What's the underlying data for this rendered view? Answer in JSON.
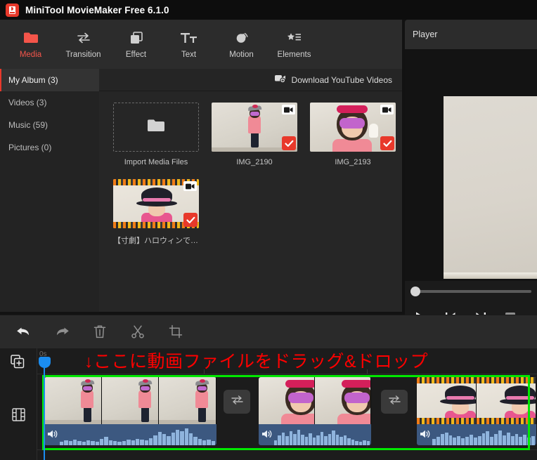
{
  "window": {
    "title": "MiniTool MovieMaker Free 6.1.0",
    "app_icon": "moviemaker-logo-icon"
  },
  "toolbar_tabs": [
    {
      "label": "Media",
      "icon": "folder-icon",
      "active": true
    },
    {
      "label": "Transition",
      "icon": "swap-arrows-icon",
      "active": false
    },
    {
      "label": "Effect",
      "icon": "layers-icon",
      "active": false
    },
    {
      "label": "Text",
      "icon": "text-tt-icon",
      "active": false
    },
    {
      "label": "Motion",
      "icon": "motion-ellipse-icon",
      "active": false
    },
    {
      "label": "Elements",
      "icon": "star-list-icon",
      "active": false
    }
  ],
  "media": {
    "album_tab": "My Album (3)",
    "download_button": "Download YouTube Videos",
    "download_icon": "youtube-download-icon",
    "categories": [
      {
        "label": "Videos (3)"
      },
      {
        "label": "Music (59)"
      },
      {
        "label": "Pictures (0)"
      }
    ],
    "import_label": "Import Media Files",
    "import_icon": "folder-open-icon",
    "items": [
      {
        "name": "IMG_2190",
        "selected": true,
        "art": "art-2190"
      },
      {
        "name": "IMG_2193",
        "selected": true,
        "art": "art-2193"
      },
      {
        "name": "【寸劇】ハロウィンでちー…",
        "selected": true,
        "art": "art-hw"
      }
    ]
  },
  "player": {
    "title": "Player",
    "controls": [
      {
        "name": "play-button",
        "icon": "play-icon"
      },
      {
        "name": "previous-frame-button",
        "icon": "skip-back-icon"
      },
      {
        "name": "next-frame-button",
        "icon": "skip-forward-icon"
      },
      {
        "name": "stop-button",
        "icon": "stop-square-icon"
      },
      {
        "name": "extra-button",
        "icon": "partial-icon"
      }
    ]
  },
  "edit_toolbar": [
    {
      "name": "undo-button",
      "icon": "undo-arrow-icon"
    },
    {
      "name": "redo-button",
      "icon": "redo-arrow-icon"
    },
    {
      "name": "delete-button",
      "icon": "trash-icon"
    },
    {
      "name": "split-button",
      "icon": "scissors-icon"
    },
    {
      "name": "crop-button",
      "icon": "crop-icon"
    }
  ],
  "timeline": {
    "time_label": "0s",
    "add_media_icon": "add-media-icon",
    "video-track-icon": "film-strip-icon",
    "hint_text": "↓ここに動画ファイルをドラッグ&ドロップ",
    "hint_color": "#ff0000",
    "highlight_color": "#00e800",
    "playhead_color": "#1b8df0",
    "clips": [
      {
        "name": "IMG_2190",
        "art": "art-2190",
        "frames": 3
      },
      {
        "name": "IMG_2193",
        "art": "art-2193",
        "frames": 2
      },
      {
        "name": "【寸劇】ハロウィンでちー…",
        "art": "art-hw",
        "frames": 2
      }
    ],
    "transitions": [
      {
        "name": "transition-slot-1",
        "icon": "swap-arrows-icon"
      },
      {
        "name": "transition-slot-2",
        "icon": "swap-arrows-icon"
      }
    ]
  },
  "colors": {
    "accent": "#e8392b",
    "tab_active_text": "#f4554a",
    "hint_red": "#ff0000",
    "selection_green": "#00e800",
    "playhead_blue": "#1b8df0",
    "audio_band": "#3c5880"
  }
}
